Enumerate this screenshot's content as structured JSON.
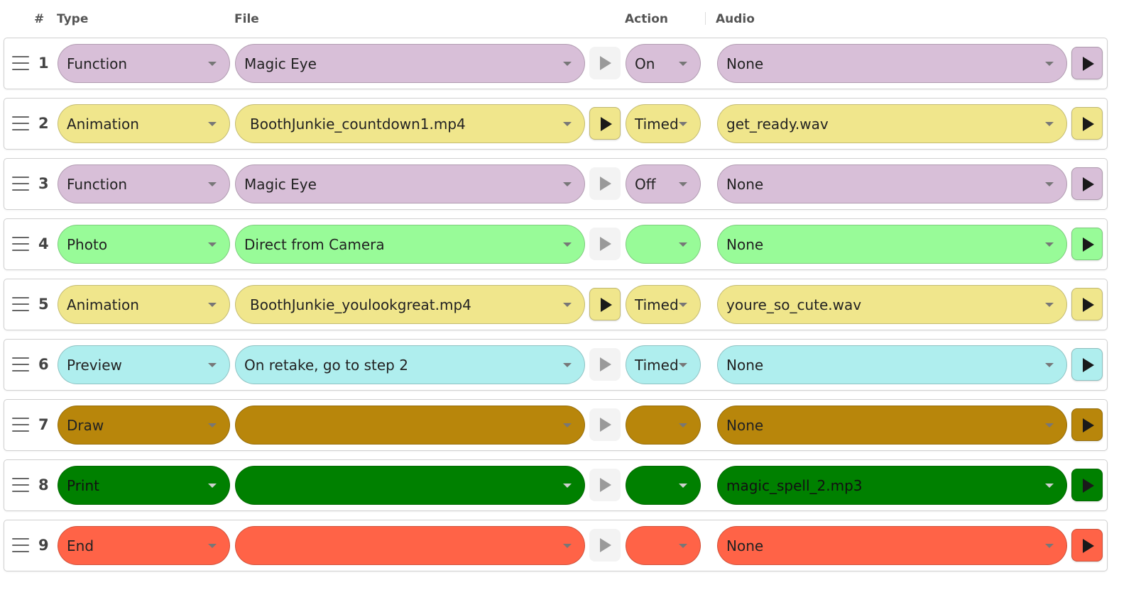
{
  "header": {
    "num": "#",
    "type": "Type",
    "file": "File",
    "action": "Action",
    "audio": "Audio"
  },
  "rows": [
    {
      "num": "1",
      "type": "Function",
      "file": "Magic Eye",
      "file_play_enabled": false,
      "action": "On",
      "audio": "None",
      "color": "#d8bfd8"
    },
    {
      "num": "2",
      "type": "Animation",
      "file": "BoothJunkie_countdown1.mp4",
      "file_play_enabled": true,
      "action": "Timed",
      "audio": "get_ready.wav",
      "color": "#f0e68c"
    },
    {
      "num": "3",
      "type": "Function",
      "file": "Magic Eye",
      "file_play_enabled": false,
      "action": "Off",
      "audio": "None",
      "color": "#d8bfd8"
    },
    {
      "num": "4",
      "type": "Photo",
      "file": "Direct from Camera",
      "file_play_enabled": false,
      "action": "",
      "audio": "None",
      "color": "#98fb98"
    },
    {
      "num": "5",
      "type": "Animation",
      "file": "BoothJunkie_youlookgreat.mp4",
      "file_play_enabled": true,
      "action": "Timed",
      "audio": "youre_so_cute.wav",
      "color": "#f0e68c"
    },
    {
      "num": "6",
      "type": "Preview",
      "file": "On retake, go to step 2",
      "file_play_enabled": false,
      "action": "Timed",
      "audio": "None",
      "color": "#afeeee"
    },
    {
      "num": "7",
      "type": "Draw",
      "file": "",
      "file_play_enabled": false,
      "action": "",
      "audio": "None",
      "color": "#b8860b"
    },
    {
      "num": "8",
      "type": "Print",
      "file": "",
      "file_play_enabled": false,
      "action": "",
      "audio": "magic_spell_2.mp3",
      "color": "#008000"
    },
    {
      "num": "9",
      "type": "End",
      "file": "",
      "file_play_enabled": false,
      "action": "",
      "audio": "None",
      "color": "#ff6347"
    }
  ],
  "icons": {
    "drag": "drag-handle-icon",
    "dropdown": "chevron-down-icon",
    "play": "play-icon"
  }
}
